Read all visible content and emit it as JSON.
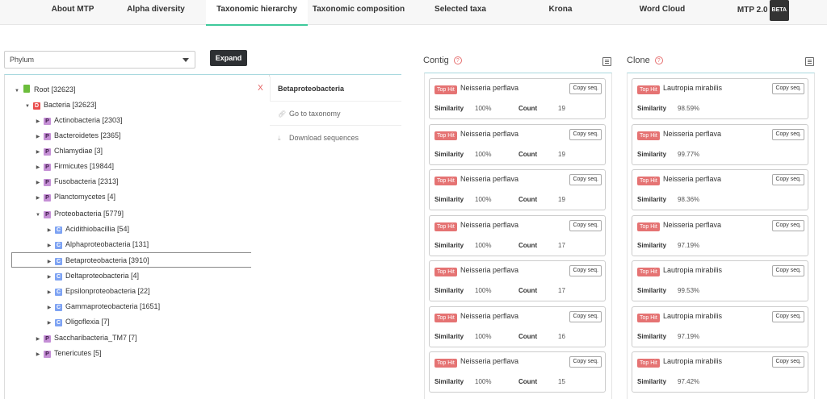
{
  "nav": {
    "tabs": [
      {
        "label": "About MTP"
      },
      {
        "label": "Alpha diversity"
      },
      {
        "label": "Taxonomic hierarchy"
      },
      {
        "label": "Taxonomic composition"
      },
      {
        "label": "Selected taxa"
      },
      {
        "label": "Krona"
      },
      {
        "label": "Word Cloud"
      },
      {
        "label": "MTP 2.0",
        "badge": "BETA"
      }
    ],
    "active": "Taxonomic hierarchy"
  },
  "controls": {
    "level_select_value": "Phylum",
    "expand_label": "Expand"
  },
  "tree": {
    "nodes": [
      {
        "badge": "R",
        "label": "Root [32623]",
        "expanded": true
      },
      {
        "badge": "D",
        "label": "Bacteria [32623]",
        "expanded": true
      },
      {
        "badge": "P",
        "label": "Actinobacteria [2303]",
        "expanded": false
      },
      {
        "badge": "P",
        "label": "Bacteroidetes [2365]",
        "expanded": false
      },
      {
        "badge": "P",
        "label": "Chlamydiae [3]",
        "expanded": false
      },
      {
        "badge": "P",
        "label": "Firmicutes [19844]",
        "expanded": false
      },
      {
        "badge": "P",
        "label": "Fusobacteria [2313]",
        "expanded": false
      },
      {
        "badge": "P",
        "label": "Planctomycetes [4]",
        "expanded": false
      },
      {
        "badge": "P",
        "label": "Proteobacteria [5779]",
        "expanded": true
      },
      {
        "badge": "C",
        "label": "Acidithiobacillia [54]",
        "expanded": false
      },
      {
        "badge": "C",
        "label": "Alphaproteobacteria [131]",
        "expanded": false
      },
      {
        "badge": "C",
        "label": "Betaproteobacteria [3910]",
        "expanded": false,
        "selected": true
      },
      {
        "badge": "C",
        "label": "Deltaproteobacteria [4]",
        "expanded": false
      },
      {
        "badge": "C",
        "label": "Epsilonproteobacteria [22]",
        "expanded": false
      },
      {
        "badge": "C",
        "label": "Gammaproteobacteria [1651]",
        "expanded": false
      },
      {
        "badge": "C",
        "label": "Oligoflexia [7]",
        "expanded": false
      },
      {
        "badge": "P",
        "label": "Saccharibacteria_TM7 [7]",
        "expanded": false
      },
      {
        "badge": "P",
        "label": "Tenericutes [5]",
        "expanded": false
      }
    ]
  },
  "context_menu": {
    "close": "X",
    "title": "Betaproteobacteria",
    "items": [
      {
        "label": "Go to taxonomy",
        "icon": "link-icon"
      },
      {
        "label": "Download sequences",
        "icon": "download-icon"
      }
    ]
  },
  "contig": {
    "title": "Contig",
    "cards": [
      {
        "tag": "Top Hit",
        "name": "Neisseria perflava",
        "copy": "Copy seq.",
        "similarity_label": "Similarity",
        "similarity": "100%",
        "count_label": "Count",
        "count": "19"
      },
      {
        "tag": "Top Hit",
        "name": "Neisseria perflava",
        "copy": "Copy seq.",
        "similarity_label": "Similarity",
        "similarity": "100%",
        "count_label": "Count",
        "count": "19"
      },
      {
        "tag": "Top Hit",
        "name": "Neisseria perflava",
        "copy": "Copy seq.",
        "similarity_label": "Similarity",
        "similarity": "100%",
        "count_label": "Count",
        "count": "19"
      },
      {
        "tag": "Top Hit",
        "name": "Neisseria perflava",
        "copy": "Copy seq.",
        "similarity_label": "Similarity",
        "similarity": "100%",
        "count_label": "Count",
        "count": "17"
      },
      {
        "tag": "Top Hit",
        "name": "Neisseria perflava",
        "copy": "Copy seq.",
        "similarity_label": "Similarity",
        "similarity": "100%",
        "count_label": "Count",
        "count": "17"
      },
      {
        "tag": "Top Hit",
        "name": "Neisseria perflava",
        "copy": "Copy seq.",
        "similarity_label": "Similarity",
        "similarity": "100%",
        "count_label": "Count",
        "count": "16"
      },
      {
        "tag": "Top Hit",
        "name": "Neisseria perflava",
        "copy": "Copy seq.",
        "similarity_label": "Similarity",
        "similarity": "100%",
        "count_label": "Count",
        "count": "15"
      }
    ]
  },
  "clone": {
    "title": "Clone",
    "cards": [
      {
        "tag": "Top Hit",
        "name": "Lautropia mirabilis",
        "copy": "Copy seq.",
        "similarity_label": "Similarity",
        "similarity": "98.59%"
      },
      {
        "tag": "Top Hit",
        "name": "Neisseria perflava",
        "copy": "Copy seq.",
        "similarity_label": "Similarity",
        "similarity": "99.77%"
      },
      {
        "tag": "Top Hit",
        "name": "Neisseria perflava",
        "copy": "Copy seq.",
        "similarity_label": "Similarity",
        "similarity": "98.36%"
      },
      {
        "tag": "Top Hit",
        "name": "Neisseria perflava",
        "copy": "Copy seq.",
        "similarity_label": "Similarity",
        "similarity": "97.19%"
      },
      {
        "tag": "Top Hit",
        "name": "Lautropia mirabilis",
        "copy": "Copy seq.",
        "similarity_label": "Similarity",
        "similarity": "99.53%"
      },
      {
        "tag": "Top Hit",
        "name": "Lautropia mirabilis",
        "copy": "Copy seq.",
        "similarity_label": "Similarity",
        "similarity": "97.19%"
      },
      {
        "tag": "Top Hit",
        "name": "Lautropia mirabilis",
        "copy": "Copy seq.",
        "similarity_label": "Similarity",
        "similarity": "97.42%"
      }
    ]
  },
  "colors": {
    "accent": "#3ec99b",
    "top_hit": "#e57373",
    "domain_badge": "#e94c4c",
    "phylum_badge": "#c58fd6",
    "class_badge": "#7ea3f3"
  }
}
